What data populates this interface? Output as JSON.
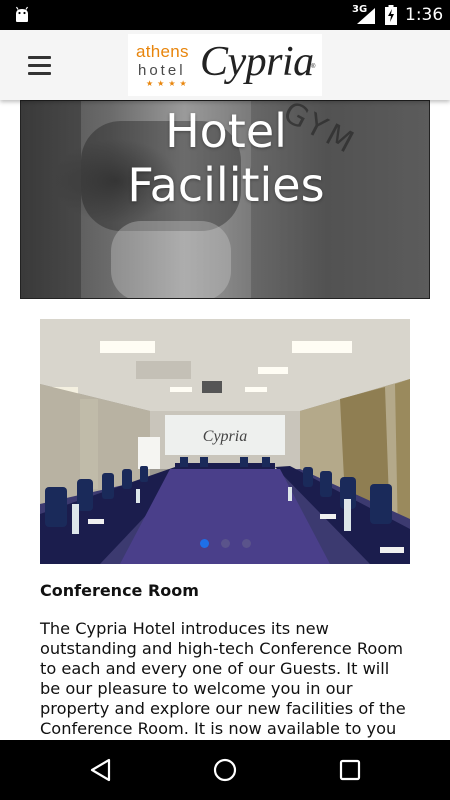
{
  "status_bar": {
    "network": "3G",
    "time": "1:36"
  },
  "app_bar": {
    "menu_icon": "hamburger-menu-icon",
    "logo": {
      "athens": "athens",
      "hotel": "hotel",
      "stars": "★★★★",
      "name": "Cypria",
      "reg": "®"
    }
  },
  "hero": {
    "title": "Hotel Facilities"
  },
  "carousel": {
    "screen_logo": "Cypria",
    "slide_count": 3,
    "active_slide": 1
  },
  "section": {
    "title": "Conference Room",
    "body": "The Cypria Hotel introduces its new outstanding and high-tech Conference Room to each and every one of our Guests. It will be our pleasure to welcome you in our property and explore our new facilities of the Conference Room. It is now available to you and you could"
  },
  "nav_bar": {
    "back_icon": "back-triangle-icon",
    "home_icon": "home-circle-icon",
    "recents_icon": "recents-square-icon"
  },
  "colors": {
    "accent": "#1e6fe8",
    "logo_orange": "#e8850c"
  }
}
